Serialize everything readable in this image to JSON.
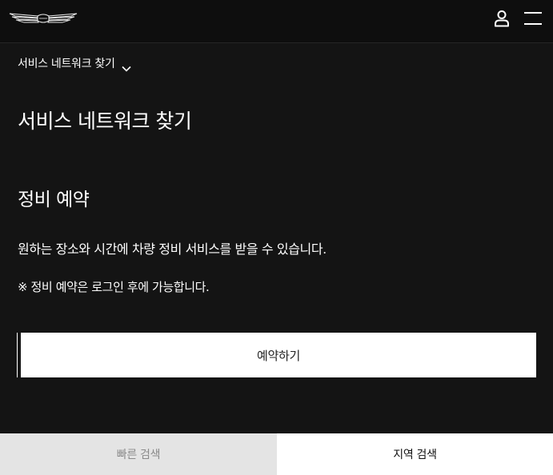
{
  "header": {
    "logo_icon": "genesis-wing-logo-icon",
    "user_icon": "user-icon",
    "menu_icon": "hamburger-menu-icon"
  },
  "breadcrumb": {
    "label": "서비스 네트워크 찾기",
    "icon": "chevron-down-icon"
  },
  "page": {
    "title": "서비스 네트워크 찾기",
    "section_title": "정비 예약",
    "description": "원하는 장소와 시간에 차량 정비 서비스를 받을 수 있습니다.",
    "note": "※ 정비 예약은 로그인 후에 가능합니다.",
    "reserve_button": "예약하기"
  },
  "tabs": [
    {
      "label": "빠른 검색",
      "active": false
    },
    {
      "label": "지역 검색",
      "active": true
    }
  ],
  "colors": {
    "background": "#141414",
    "header_bg": "#0e0e0e",
    "text": "#ffffff",
    "button_bg": "#ffffff",
    "tab_inactive_bg": "#e4e4e4",
    "tab_inactive_text": "#8a8a8a",
    "tab_active_bg": "#ffffff"
  }
}
